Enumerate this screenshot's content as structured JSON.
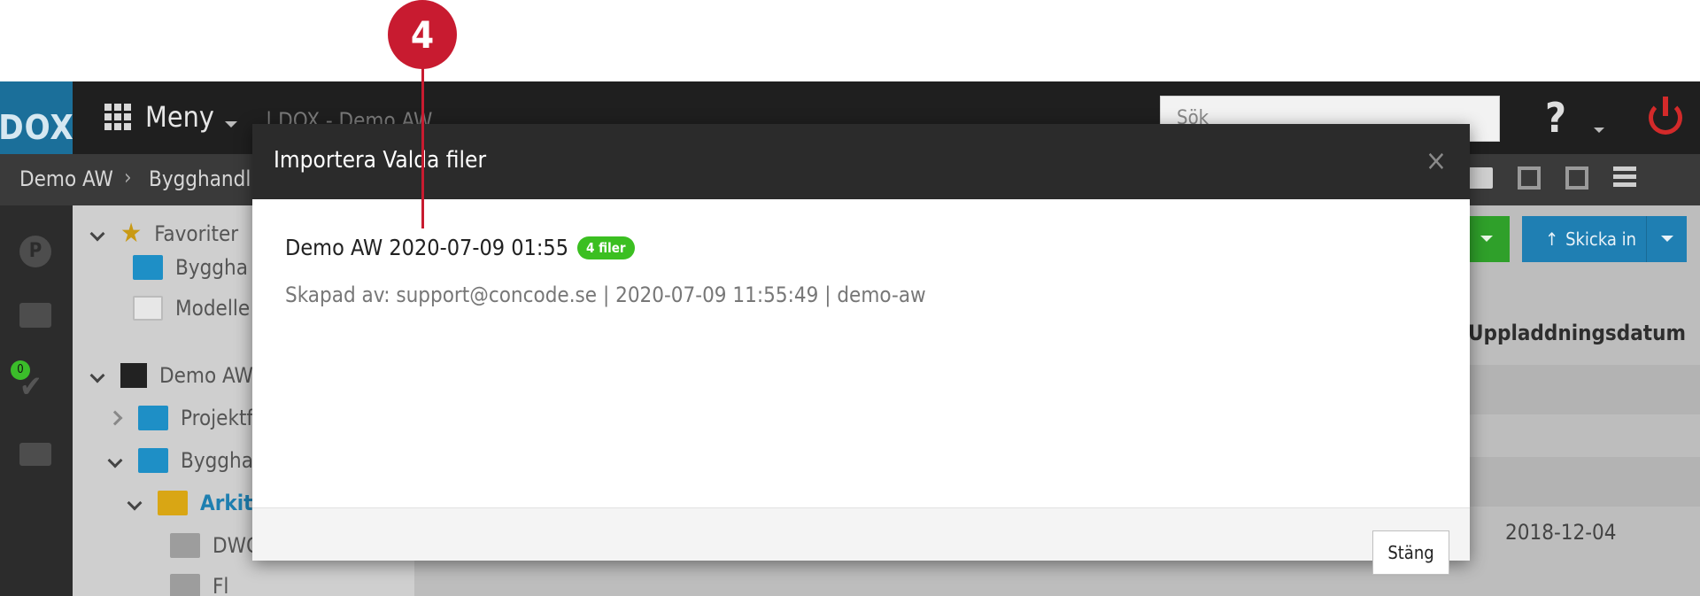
{
  "callout": {
    "number": "4"
  },
  "app": {
    "logo": "DOX",
    "menu_label": "Meny",
    "header_crumb": "| DOX - Demo AW",
    "search_placeholder": "Sök",
    "help_label": "?",
    "breadcrumb": {
      "first": "Demo AW",
      "second": "Bygghandli"
    },
    "rail_badge": "0",
    "tree": {
      "favorites": "Favoriter",
      "fav_item_1": "Byggha",
      "fav_item_2": "Modelle",
      "project": "Demo AW",
      "folder_1": "Projektf",
      "folder_2": "Bygghar",
      "folder_3": "Arkite",
      "folder_4": "DWG",
      "folder_5": "Fl"
    },
    "submit_label": "Skicka in",
    "column_header": "Uppladdningsdatum",
    "date_cell": "2018-12-04"
  },
  "modal": {
    "title": "Importera Valda filer",
    "close_icon": "×",
    "import_name": "Demo AW 2020-07-09 01:55",
    "file_count": "4 filer",
    "meta": "Skapad av: support@concode.se | 2020-07-09 11:55:49 | demo-aw",
    "close_button": "Stäng"
  },
  "colors": {
    "callout": "#c81b30",
    "badge_green": "#3bbf21",
    "header_dark": "#2b2b2b",
    "brand_blue": "#1b6f9a"
  }
}
